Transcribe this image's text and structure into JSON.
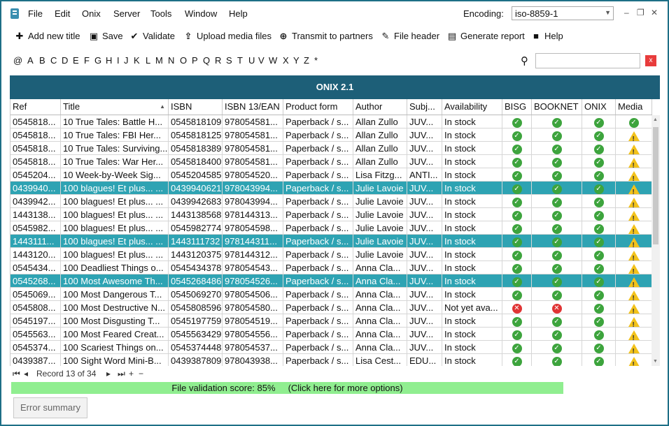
{
  "menu": [
    "File",
    "Edit",
    "Onix",
    "Server",
    "Tools",
    "Window",
    "Help"
  ],
  "encoding": {
    "label": "Encoding:",
    "value": "iso-8859-1"
  },
  "toolbar": {
    "add": "Add new title",
    "save": "Save",
    "validate": "Validate",
    "upload": "Upload media files",
    "transmit": "Transmit to partners",
    "header": "File header",
    "report": "Generate report",
    "help": "Help"
  },
  "alphabet": [
    "@",
    "A",
    "B",
    "C",
    "D",
    "E",
    "F",
    "G",
    "H",
    "I",
    "J",
    "K",
    "L",
    "M",
    "N",
    "O",
    "P",
    "Q",
    "R",
    "S",
    "T",
    "U",
    "V",
    "W",
    "X",
    "Y",
    "Z",
    "*"
  ],
  "search": {
    "value": "",
    "clear": "x"
  },
  "grid": {
    "title": "ONIX 2.1",
    "columns": [
      "Ref",
      "Title",
      "ISBN",
      "ISBN 13/EAN",
      "Product form",
      "Author",
      "Subj...",
      "Availability",
      "BISG",
      "BOOKNET",
      "ONIX",
      "Media"
    ],
    "rows": [
      {
        "ref": "0545818...",
        "title": "10 True Tales: Battle H...",
        "isbn": "0545818109",
        "ean": "978054581...",
        "form": "Paperback / s...",
        "author": "Allan Zullo",
        "subj": "JUV...",
        "avail": "In stock",
        "bisg": "ok",
        "booknet": "ok",
        "onix": "ok",
        "media": "ok",
        "sel": false
      },
      {
        "ref": "0545818...",
        "title": "10 True Tales: FBI Her...",
        "isbn": "0545818125",
        "ean": "978054581...",
        "form": "Paperback / s...",
        "author": "Allan Zullo",
        "subj": "JUV...",
        "avail": "In stock",
        "bisg": "ok",
        "booknet": "ok",
        "onix": "ok",
        "media": "warn",
        "sel": false
      },
      {
        "ref": "0545818...",
        "title": "10 True Tales: Surviving...",
        "isbn": "0545818389",
        "ean": "978054581...",
        "form": "Paperback / s...",
        "author": "Allan Zullo",
        "subj": "JUV...",
        "avail": "In stock",
        "bisg": "ok",
        "booknet": "ok",
        "onix": "ok",
        "media": "warn",
        "sel": false
      },
      {
        "ref": "0545818...",
        "title": "10 True Tales: War Her...",
        "isbn": "0545818400",
        "ean": "978054581...",
        "form": "Paperback / s...",
        "author": "Allan Zullo",
        "subj": "JUV...",
        "avail": "In stock",
        "bisg": "ok",
        "booknet": "ok",
        "onix": "ok",
        "media": "warn",
        "sel": false
      },
      {
        "ref": "0545204...",
        "title": "10 Week-by-Week Sig...",
        "isbn": "0545204585",
        "ean": "978054520...",
        "form": "Paperback / s...",
        "author": "Lisa Fitzg...",
        "subj": "ANTI...",
        "avail": "In stock",
        "bisg": "ok",
        "booknet": "ok",
        "onix": "ok",
        "media": "warn",
        "sel": false
      },
      {
        "ref": "0439940...",
        "title": "100 blagues! Et plus... ...",
        "isbn": "0439940621",
        "ean": "978043994...",
        "form": "Paperback / s...",
        "author": "Julie Lavoie",
        "subj": "JUV...",
        "avail": "In stock",
        "bisg": "ok",
        "booknet": "ok",
        "onix": "ok",
        "media": "warn",
        "sel": true
      },
      {
        "ref": "0439942...",
        "title": "100 blagues! Et plus... ...",
        "isbn": "0439942683",
        "ean": "978043994...",
        "form": "Paperback / s...",
        "author": "Julie Lavoie",
        "subj": "JUV...",
        "avail": "In stock",
        "bisg": "ok",
        "booknet": "ok",
        "onix": "ok",
        "media": "warn",
        "sel": false
      },
      {
        "ref": "1443138...",
        "title": "100 blagues! Et plus... ...",
        "isbn": "1443138568",
        "ean": "978144313...",
        "form": "Paperback / s...",
        "author": "Julie Lavoie",
        "subj": "JUV...",
        "avail": "In stock",
        "bisg": "ok",
        "booknet": "ok",
        "onix": "ok",
        "media": "warn",
        "sel": false
      },
      {
        "ref": "0545982...",
        "title": "100 blagues! Et plus... ...",
        "isbn": "0545982774",
        "ean": "978054598...",
        "form": "Paperback / s...",
        "author": "Julie Lavoie",
        "subj": "JUV...",
        "avail": "In stock",
        "bisg": "ok",
        "booknet": "ok",
        "onix": "ok",
        "media": "warn",
        "sel": false
      },
      {
        "ref": "1443111...",
        "title": "100 blagues! Et plus... ...",
        "isbn": "1443111732",
        "ean": "978144311...",
        "form": "Paperback / s...",
        "author": "Julie Lavoie",
        "subj": "JUV...",
        "avail": "In stock",
        "bisg": "ok",
        "booknet": "ok",
        "onix": "ok",
        "media": "warn",
        "sel": true
      },
      {
        "ref": "1443120...",
        "title": "100 blagues! Et plus... ...",
        "isbn": "1443120375",
        "ean": "978144312...",
        "form": "Paperback / s...",
        "author": "Julie Lavoie",
        "subj": "JUV...",
        "avail": "In stock",
        "bisg": "ok",
        "booknet": "ok",
        "onix": "ok",
        "media": "warn",
        "sel": false
      },
      {
        "ref": "0545434...",
        "title": "100 Deadliest Things o...",
        "isbn": "0545434378",
        "ean": "978054543...",
        "form": "Paperback / s...",
        "author": "Anna Cla...",
        "subj": "JUV...",
        "avail": "In stock",
        "bisg": "ok",
        "booknet": "ok",
        "onix": "ok",
        "media": "warn",
        "sel": false
      },
      {
        "ref": "0545268...",
        "title": "100 Most Awesome Th...",
        "isbn": "0545268486",
        "ean": "978054526...",
        "form": "Paperback / s...",
        "author": "Anna Cla...",
        "subj": "JUV...",
        "avail": "In stock",
        "bisg": "ok",
        "booknet": "ok",
        "onix": "ok",
        "media": "warn",
        "sel": true
      },
      {
        "ref": "0545069...",
        "title": "100 Most Dangerous T...",
        "isbn": "0545069270",
        "ean": "978054506...",
        "form": "Paperback / s...",
        "author": "Anna Cla...",
        "subj": "JUV...",
        "avail": "In stock",
        "bisg": "ok",
        "booknet": "ok",
        "onix": "ok",
        "media": "warn",
        "sel": false
      },
      {
        "ref": "0545808...",
        "title": "100 Most Destructive N...",
        "isbn": "0545808596",
        "ean": "978054580...",
        "form": "Paperback / s...",
        "author": "Anna Cla...",
        "subj": "JUV...",
        "avail": "Not yet ava...",
        "bisg": "err",
        "booknet": "err",
        "onix": "ok",
        "media": "warn",
        "sel": false
      },
      {
        "ref": "0545197...",
        "title": "100 Most Disgusting T...",
        "isbn": "0545197759",
        "ean": "978054519...",
        "form": "Paperback / s...",
        "author": "Anna Cla...",
        "subj": "JUV...",
        "avail": "In stock",
        "bisg": "ok",
        "booknet": "ok",
        "onix": "ok",
        "media": "warn",
        "sel": false
      },
      {
        "ref": "0545563...",
        "title": "100 Most Feared Creat...",
        "isbn": "0545563429",
        "ean": "978054556...",
        "form": "Paperback / s...",
        "author": "Anna Cla...",
        "subj": "JUV...",
        "avail": "In stock",
        "bisg": "ok",
        "booknet": "ok",
        "onix": "ok",
        "media": "warn",
        "sel": false
      },
      {
        "ref": "0545374...",
        "title": "100 Scariest Things on...",
        "isbn": "0545374448",
        "ean": "978054537...",
        "form": "Paperback / s...",
        "author": "Anna Cla...",
        "subj": "JUV...",
        "avail": "In stock",
        "bisg": "ok",
        "booknet": "ok",
        "onix": "ok",
        "media": "warn",
        "sel": false
      },
      {
        "ref": "0439387...",
        "title": "100 Sight Word Mini-B...",
        "isbn": "0439387809",
        "ean": "978043938...",
        "form": "Paperback / s...",
        "author": "Lisa Cest...",
        "subj": "EDU...",
        "avail": "In stock",
        "bisg": "ok",
        "booknet": "ok",
        "onix": "ok",
        "media": "warn",
        "sel": false
      }
    ]
  },
  "navigator": {
    "record": "Record 13 of 34"
  },
  "validation": {
    "score": "File validation score: 85%",
    "more": "(Click here for more options)"
  },
  "error_summary": "Error summary"
}
